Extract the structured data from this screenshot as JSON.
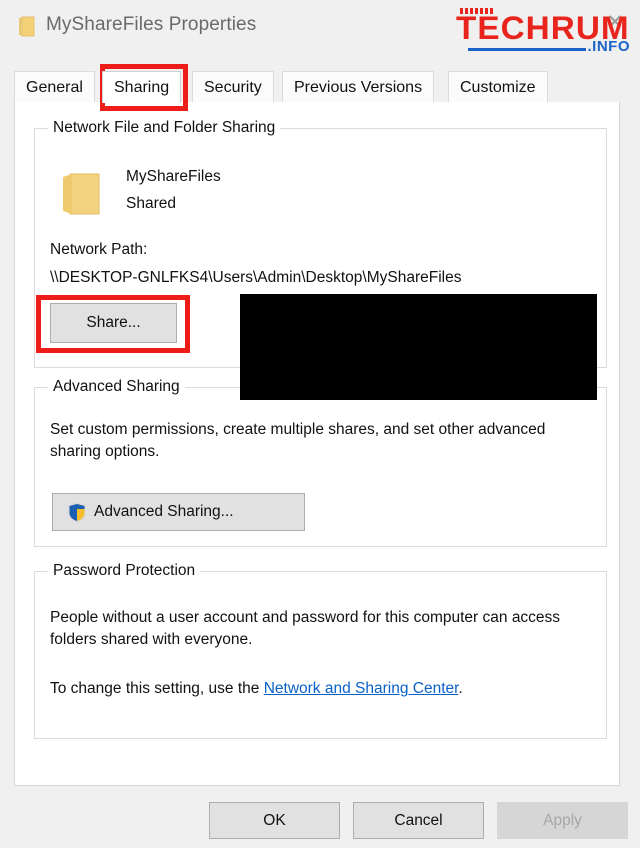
{
  "window": {
    "title": "MyShareFiles Properties",
    "folder_icon": "folder-icon",
    "close_label": "✕"
  },
  "watermark": {
    "brand": "TECHRUM",
    "suffix": ".INFO",
    "brand_color": "#e8241c",
    "suffix_color": "#1b63c8"
  },
  "tabs": [
    {
      "label": "General",
      "selected": false
    },
    {
      "label": "Sharing",
      "selected": true
    },
    {
      "label": "Security",
      "selected": false
    },
    {
      "label": "Previous Versions",
      "selected": false
    },
    {
      "label": "Customize",
      "selected": false
    }
  ],
  "network_sharing": {
    "group_title": "Network File and Folder Sharing",
    "folder_icon": "folder-icon",
    "item_name": "MyShareFiles",
    "item_state": "Shared",
    "path_label": "Network Path:",
    "path_value": "\\\\DESKTOP-GNLFKS4\\Users\\Admin\\Desktop\\MyShareFiles",
    "share_button": "Share..."
  },
  "advanced_sharing": {
    "group_title": "Advanced Sharing",
    "description": "Set custom permissions, create multiple shares, and set other advanced sharing options.",
    "button_label": "Advanced Sharing...",
    "button_icon": "uac-shield-icon"
  },
  "password_protection": {
    "group_title": "Password Protection",
    "description": "People without a user account and password for this computer can access folders shared with everyone.",
    "change_prefix": "To change this setting, use the ",
    "link_text": "Network and Sharing Center",
    "change_suffix": ".",
    "link_color": "#0a62c8"
  },
  "footer": {
    "ok": "OK",
    "cancel": "Cancel",
    "apply": "Apply",
    "apply_disabled": true
  },
  "annotations": {
    "highlight_color": "#ee1c18",
    "redaction_color": "#000000"
  }
}
